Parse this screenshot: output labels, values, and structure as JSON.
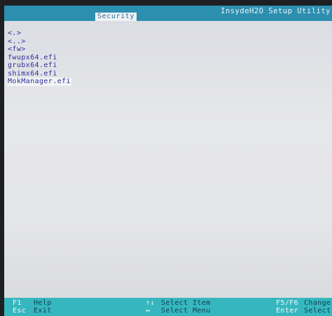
{
  "header": {
    "title": "InsydeH2O Setup Utility",
    "active_tab": "Security"
  },
  "file_list": {
    "items": [
      {
        "label": "<.>",
        "selected": false
      },
      {
        "label": "<..>",
        "selected": false
      },
      {
        "label": "<fw>",
        "selected": false
      },
      {
        "label": "fwupx64.efi",
        "selected": false
      },
      {
        "label": "grubx64.efi",
        "selected": false
      },
      {
        "label": "shimx64.efi",
        "selected": false
      },
      {
        "label": "MokManager.efi",
        "selected": true
      }
    ]
  },
  "footer": {
    "f1_key": "F1",
    "f1_label": "Help",
    "esc_key": "Esc",
    "esc_label": "Exit",
    "updown_key": "↑↓",
    "updown_label": "Select Item",
    "leftright_key": "↔",
    "leftright_label": "Select Menu",
    "f5f6_key": "F5/F6",
    "f5f6_label": "Change",
    "enter_key": "Enter",
    "enter_label": "Select"
  },
  "colors": {
    "header_bg": "#2c8fb0",
    "panel_bg": "#e5e6e8",
    "text_blue": "#2d2f9a",
    "footer_bg": "#36b7bf"
  }
}
